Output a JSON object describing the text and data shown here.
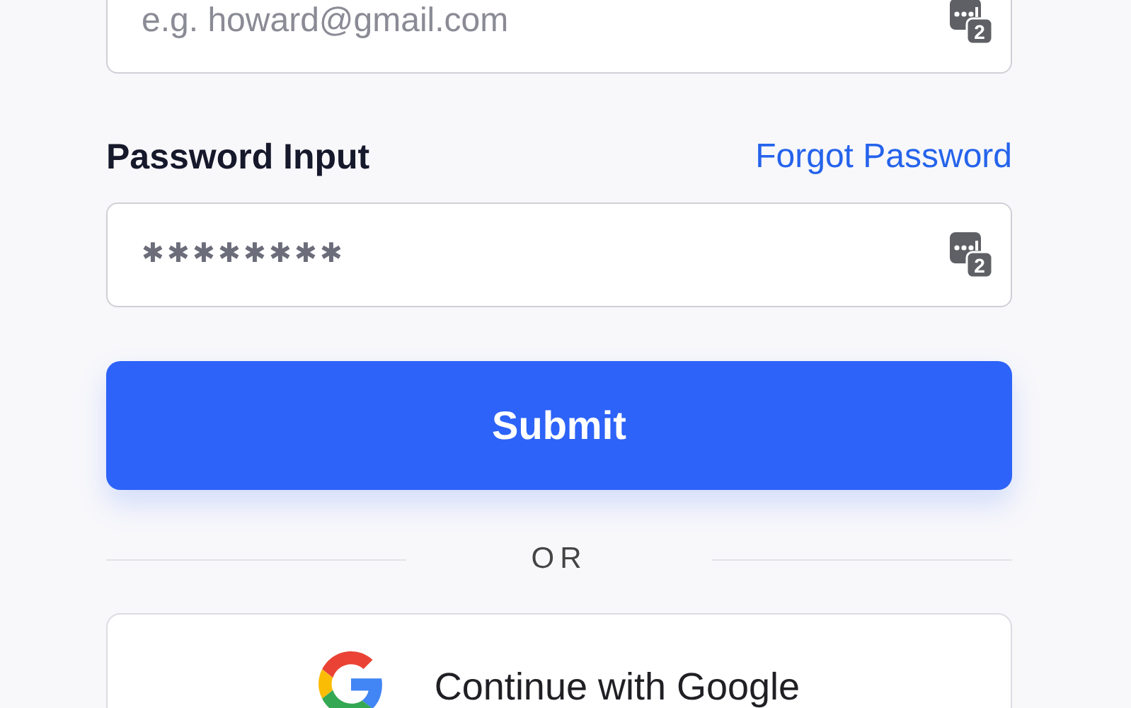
{
  "fields": [
    {
      "kind": "email",
      "placeholder": "e.g. howard@gmail.com",
      "manager_badge": "2"
    },
    {
      "kind": "password",
      "label": "Password Input",
      "link": "Forgot Password",
      "placeholder": "✱✱✱✱✱✱✱✱",
      "manager_badge": "2"
    }
  ],
  "submit": "Submit",
  "divider": "OR",
  "google_button": "Continue with Google"
}
